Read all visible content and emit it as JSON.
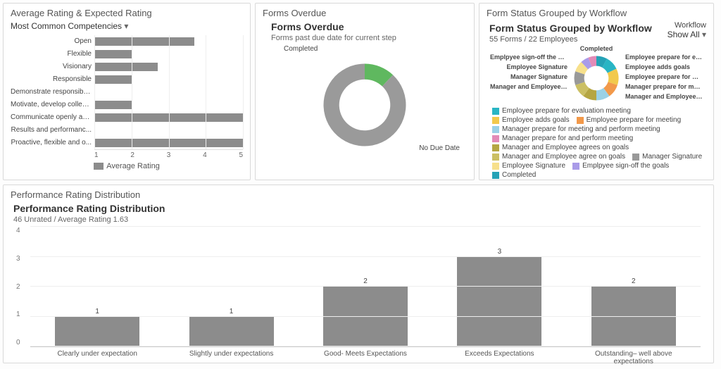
{
  "avg_panel": {
    "title": "Average Rating & Expected Rating",
    "dropdown": "Most Common Competencies",
    "legend": "Average Rating"
  },
  "overdue_panel": {
    "title": "Forms Overdue",
    "subtitle": "Forms Overdue",
    "desc": "Forms past due date for current step",
    "completed_label": "Completed",
    "nodue_label": "No Due Date"
  },
  "wf_panel": {
    "title": "Form Status Grouped by Workflow",
    "subtitle": "Form Status Grouped by Workflow",
    "count": "55 Forms / 22 Employees",
    "drop_label": "Workflow",
    "drop_value": "Show All",
    "ring_left": [
      "Emplpyee sign-off the goals",
      "Employee Signature",
      "Manager Signature",
      "Manager and Employee agree on g..."
    ],
    "ring_top": "Completed",
    "ring_right": [
      "Employee prepare for evaluation...",
      "Employee adds goals",
      "Employee prepare for meeting",
      "Manager prepare for meeting...",
      "Manager and Employee agrees on..."
    ],
    "legend": [
      {
        "c": "#29b5c4",
        "t": "Employee prepare for evaluation meeting"
      },
      {
        "c": "#f2c94c",
        "t": "Employee adds goals"
      },
      {
        "c": "#f2994a",
        "t": "Employee prepare for meeting"
      },
      {
        "c": "#9ad1e6",
        "t": "Manager prepare for meeting and perform meeting"
      },
      {
        "c": "#e28bb7",
        "t": "Manager prepare for and perform meeting"
      },
      {
        "c": "#b5a642",
        "t": "Manager and Employee agrees on goals"
      },
      {
        "c": "#cbbf63",
        "t": "Manager and Employee agree on goals"
      },
      {
        "c": "#999999",
        "t": "Manager Signature"
      },
      {
        "c": "#f7e08b",
        "t": "Employee Signature"
      },
      {
        "c": "#a99be8",
        "t": "Emplpyee sign-off the goals"
      },
      {
        "c": "#25a2b6",
        "t": "Completed"
      }
    ]
  },
  "perf_panel": {
    "title": "Performance Rating Distribution",
    "subtitle": "Performance Rating Distribution",
    "meta": "46 Unrated / Average Rating 1.63"
  },
  "chart_data": [
    {
      "id": "avg_rating_bar",
      "type": "bar",
      "orientation": "horizontal",
      "categories": [
        "Open",
        "Flexible",
        "Visionary",
        "Responsible",
        "Demonstrate responsibil...",
        "Motivate, develop collea...",
        "Communicate openly an...",
        "Results and performanc...",
        "Proactive, flexible and o..."
      ],
      "values": [
        3.7,
        2.0,
        2.7,
        2.0,
        0,
        2.0,
        5.0,
        0,
        5.0
      ],
      "xlim": [
        1,
        5
      ],
      "xticks": [
        1,
        2,
        3,
        4,
        5
      ],
      "series_name": "Average Rating"
    },
    {
      "id": "forms_overdue_donut",
      "type": "pie",
      "hole": 0.62,
      "slices": [
        {
          "label": "Completed",
          "value": 12,
          "color": "#5fb85f"
        },
        {
          "label": "No Due Date",
          "value": 88,
          "color": "#9a9a9a"
        }
      ]
    },
    {
      "id": "workflow_donut",
      "type": "pie",
      "hole": 0.55,
      "slices": [
        {
          "label": "Completed",
          "value": 8,
          "color": "#25a2b6"
        },
        {
          "label": "Employee prepare for evaluation meeting",
          "value": 10,
          "color": "#29b5c4"
        },
        {
          "label": "Employee adds goals",
          "value": 12,
          "color": "#f2c94c"
        },
        {
          "label": "Employee prepare for meeting",
          "value": 10,
          "color": "#f2994a"
        },
        {
          "label": "Manager prepare for meeting and perform meeting",
          "value": 10,
          "color": "#9ad1e6"
        },
        {
          "label": "Manager and Employee agrees on goals",
          "value": 10,
          "color": "#b5a642"
        },
        {
          "label": "Manager and Employee agree on goals",
          "value": 10,
          "color": "#cbbf63"
        },
        {
          "label": "Manager Signature",
          "value": 10,
          "color": "#999999"
        },
        {
          "label": "Employee Signature",
          "value": 8,
          "color": "#f7e08b"
        },
        {
          "label": "Emplpyee sign-off the goals",
          "value": 6,
          "color": "#a99be8"
        },
        {
          "label": "Manager prepare for and perform meeting",
          "value": 6,
          "color": "#e28bb7"
        }
      ]
    },
    {
      "id": "perf_rating_bar",
      "type": "bar",
      "categories": [
        "Clearly under expectation",
        "Slightly under expectations",
        "Good- Meets Expectations",
        "Exceeds Expectations",
        "Outstanding– well above expectations"
      ],
      "values": [
        1,
        1,
        2,
        3,
        2
      ],
      "ylim": [
        0,
        4
      ],
      "yticks": [
        0,
        1,
        2,
        3,
        4
      ]
    }
  ]
}
